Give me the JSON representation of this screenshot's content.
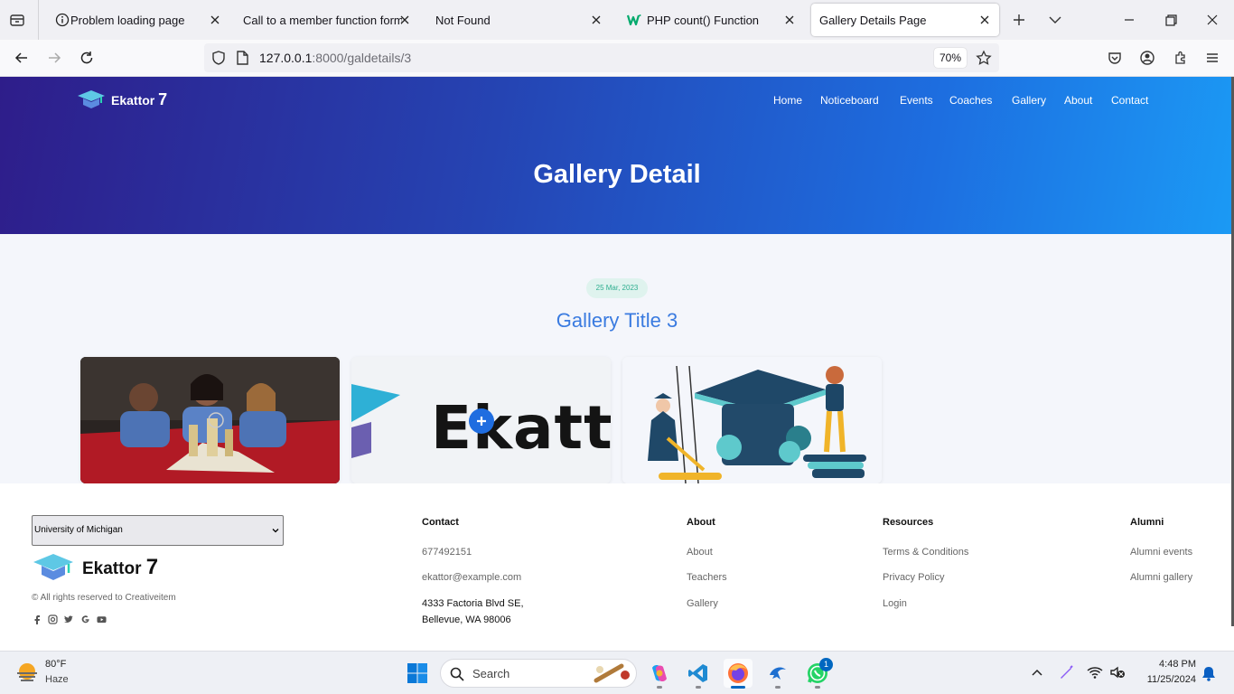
{
  "browser": {
    "tabs": [
      {
        "title": "Problem loading page",
        "icon": "info-icon",
        "active": false
      },
      {
        "title": "Call to a member function forma",
        "icon": "",
        "active": false
      },
      {
        "title": "Not Found",
        "icon": "",
        "active": false
      },
      {
        "title": "PHP count() Function",
        "icon": "w3schools-icon",
        "active": false
      },
      {
        "title": "Gallery Details Page",
        "icon": "",
        "active": true
      }
    ],
    "url_host": "127.0.0.1",
    "url_rest": ":8000/galdetails/3",
    "zoom": "70%"
  },
  "site": {
    "brand": "Ekattor",
    "brand_num": "7",
    "menu": [
      "Home",
      "Noticeboard",
      "Events",
      "Coaches",
      "Gallery",
      "About",
      "Contact"
    ],
    "hero_title": "Gallery Detail",
    "date": "25 Mar, 2023",
    "gallery_title": "Gallery Title 3",
    "logo_card_text": "Ekatto"
  },
  "footer": {
    "university": "University of Michigan",
    "copyright": "© All rights reserved to Creativeitem",
    "contact": {
      "heading": "Contact",
      "phone": "677492151",
      "email": "ekattor@example.com",
      "address_line1": "4333 Factoria Blvd SE,",
      "address_line2": "Bellevue, WA 98006"
    },
    "about": {
      "heading": "About",
      "links": [
        "About",
        "Teachers",
        "Gallery"
      ]
    },
    "resources": {
      "heading": "Resources",
      "links": [
        "Terms & Conditions",
        "Privacy Policy",
        "Login"
      ]
    },
    "alumni": {
      "heading": "Alumni",
      "links": [
        "Alumni events",
        "Alumni gallery"
      ]
    }
  },
  "taskbar": {
    "weather_temp": "80°F",
    "weather_desc": "Haze",
    "search_placeholder": "Search",
    "time": "4:48 PM",
    "date": "11/25/2024",
    "whatsapp_badge": "1"
  },
  "colors": {
    "hero_start": "#2e1d8a",
    "hero_end": "#1b9af5",
    "gallery_title": "#3a7be0",
    "date_pill_text": "#2eae8f"
  }
}
